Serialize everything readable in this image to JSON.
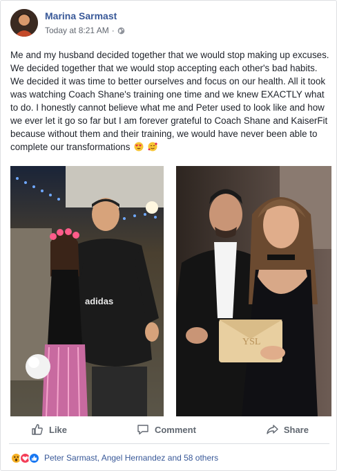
{
  "post": {
    "author": "Marina Sarmast",
    "timestamp": "Today at 8:21 AM",
    "separator": "·",
    "body": "Me and my husband decided together that we would stop making up excuses. We decided together that we would stop accepting each other's bad habits. We decided it was time to better ourselves and focus on our health. All it took was watching Coach Shane's training one time and we knew EXACTLY what to do. I honestly cannot believe what me and Peter used to look like and how we ever let it go so far but I am forever grateful to Coach Shane and KaiserFit because without them and their training, we would have never been able to complete our transformations",
    "emojis": [
      "heart-eyes-emoji",
      "smiling-face-with-hearts-emoji"
    ],
    "shirt_text": "adidas"
  },
  "actions": {
    "like": "Like",
    "comment": "Comment",
    "share": "Share"
  },
  "reactions": {
    "icons": [
      "wow-reaction-icon",
      "love-reaction-icon",
      "like-reaction-icon"
    ],
    "summary": "Peter Sarmast, Angel Hernandez and 58 others"
  },
  "colors": {
    "link_blue": "#385898",
    "action_gray": "#606770",
    "wow_yellow": "#f7b125",
    "love_red": "#f33e58",
    "like_blue": "#1877f2"
  }
}
